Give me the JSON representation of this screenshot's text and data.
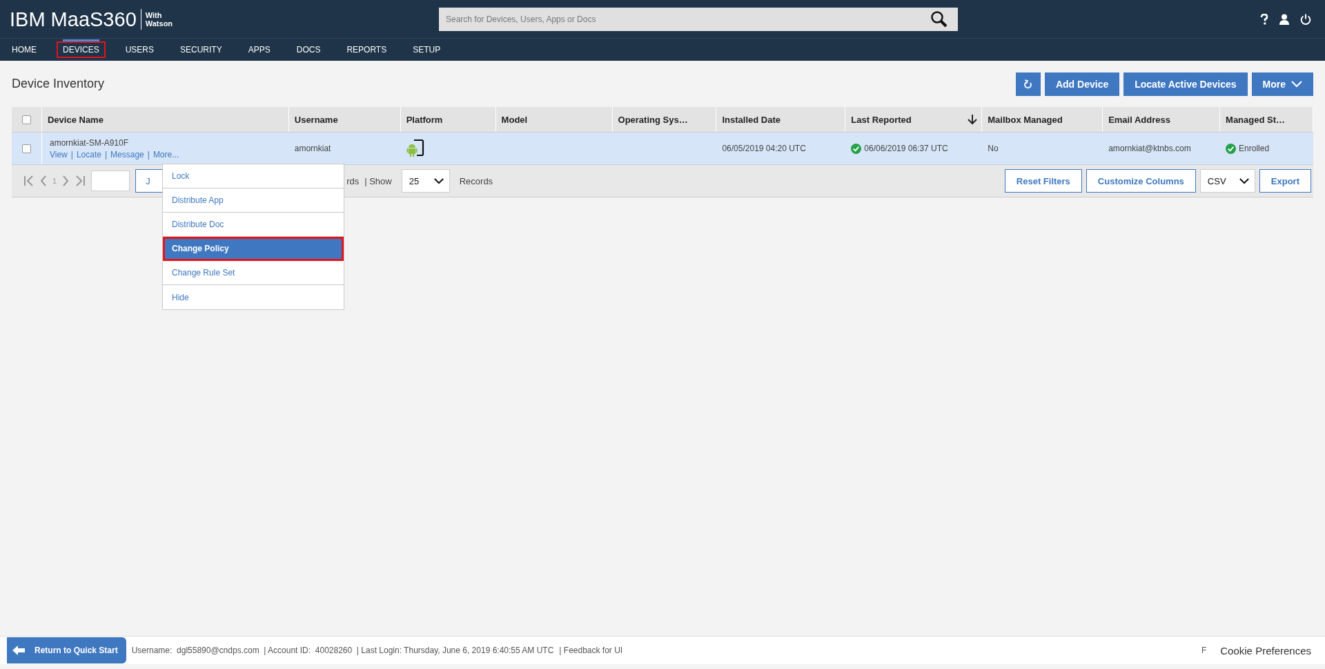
{
  "header": {
    "logo": "IBM MaaS360",
    "logo_suffix_1": "With",
    "logo_suffix_2": "Watson",
    "search": {
      "placeholder": "Search for Devices, Users, Apps or Docs"
    }
  },
  "nav": [
    {
      "label": "HOME",
      "selected": false,
      "outlined": false
    },
    {
      "label": "DEVICES",
      "selected": true,
      "outlined": true
    },
    {
      "label": "USERS",
      "selected": false,
      "outlined": false
    },
    {
      "label": "SECURITY",
      "selected": false,
      "outlined": false
    },
    {
      "label": "APPS",
      "selected": false,
      "outlined": false
    },
    {
      "label": "DOCS",
      "selected": false,
      "outlined": false
    },
    {
      "label": "REPORTS",
      "selected": false,
      "outlined": false
    },
    {
      "label": "SETUP",
      "selected": false,
      "outlined": false
    }
  ],
  "page_title": "Device Inventory",
  "actions": [
    "Add Device",
    "Locate Active Devices",
    "More"
  ],
  "table": {
    "columns": [
      {
        "label": "Device Name",
        "sorted": false
      },
      {
        "label": "Username",
        "sorted": false
      },
      {
        "label": "Platform",
        "sorted": false
      },
      {
        "label": "Model",
        "sorted": false
      },
      {
        "label": "Operating Sys…",
        "sorted": false
      },
      {
        "label": "Installed Date",
        "sorted": false
      },
      {
        "label": "Last Reported",
        "sorted": true
      },
      {
        "label": "Mailbox Managed",
        "sorted": false
      },
      {
        "label": "Email Address",
        "sorted": false
      },
      {
        "label": "Managed St…",
        "sorted": false
      }
    ],
    "all_checked": false,
    "link_separator": "|",
    "rows": [
      {
        "checked": false,
        "device_name": "amornkiat-SM-A910F",
        "links": [
          "View",
          "Locate",
          "Message",
          "More..."
        ],
        "username": "amornkiat",
        "installed_date": "06/05/2019 04:20 UTC",
        "last_reported": "06/06/2019 06:37 UTC",
        "mailbox_managed": "No",
        "email": "amornkiat@ktnbs.com",
        "managed_status": "Enrolled"
      }
    ]
  },
  "pagination": {
    "page": "1",
    "jump_button": "J",
    "records_text": "rds",
    "show_label": "| Show",
    "page_size": "25",
    "records_label": "Records"
  },
  "table_actions": {
    "reset": "Reset Filters",
    "customize": "Customize Columns",
    "format": "CSV",
    "export": "Export"
  },
  "more_menu": [
    {
      "label": "Lock",
      "selected": false,
      "outlined": false
    },
    {
      "label": "Distribute App",
      "selected": false,
      "outlined": false
    },
    {
      "label": "Distribute Doc",
      "selected": false,
      "outlined": false
    },
    {
      "label": "Change Policy",
      "selected": true,
      "outlined": true
    },
    {
      "label": "Change Rule Set",
      "selected": false,
      "outlined": false
    },
    {
      "label": "Hide",
      "selected": false,
      "outlined": false
    }
  ],
  "footer": {
    "return_button": "Return to Quick Start",
    "info": "Username:  dgl55890@cndps.com  | Account ID:  40028260  | Last Login: Thursday, June 6, 2019 6:40:55 AM UTC",
    "feedback": "| Feedback for UI",
    "cut_text": "F",
    "cookie": "Cookie Preferences"
  }
}
